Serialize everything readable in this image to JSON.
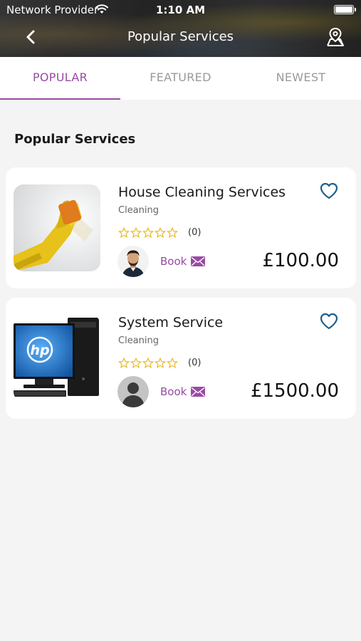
{
  "status_bar": {
    "carrier": "Network Provider",
    "time": "1:10 AM",
    "battery_level": 1.0
  },
  "header": {
    "title": "Popular Services",
    "back_icon": "chevron-left-icon",
    "location_icon": "map-pin-icon"
  },
  "tabs": [
    {
      "label": "POPULAR",
      "active": true
    },
    {
      "label": "FEATURED",
      "active": false
    },
    {
      "label": "NEWEST",
      "active": false
    }
  ],
  "section_title": "Popular Services",
  "services": [
    {
      "name": "House Cleaning Services",
      "category": "Cleaning",
      "rating": 0,
      "max_rating": 5,
      "review_count": "(0)",
      "book_label": "Book",
      "price": "£100.00",
      "favorite_icon": "heart-outline-icon",
      "image": "gloved-hand-cleaning-window",
      "provider_avatar": "man-portrait"
    },
    {
      "name": "System Service",
      "category": "Cleaning",
      "rating": 0,
      "max_rating": 5,
      "review_count": "(0)",
      "book_label": "Book",
      "price": "£1500.00",
      "favorite_icon": "heart-outline-icon",
      "image": "hp-desktop-computer",
      "provider_avatar": "default-person-avatar"
    }
  ],
  "colors": {
    "accent": "#9a4aa6",
    "heart": "#1f5f8b",
    "star": "#e8b923",
    "background": "#f4f4f4"
  }
}
